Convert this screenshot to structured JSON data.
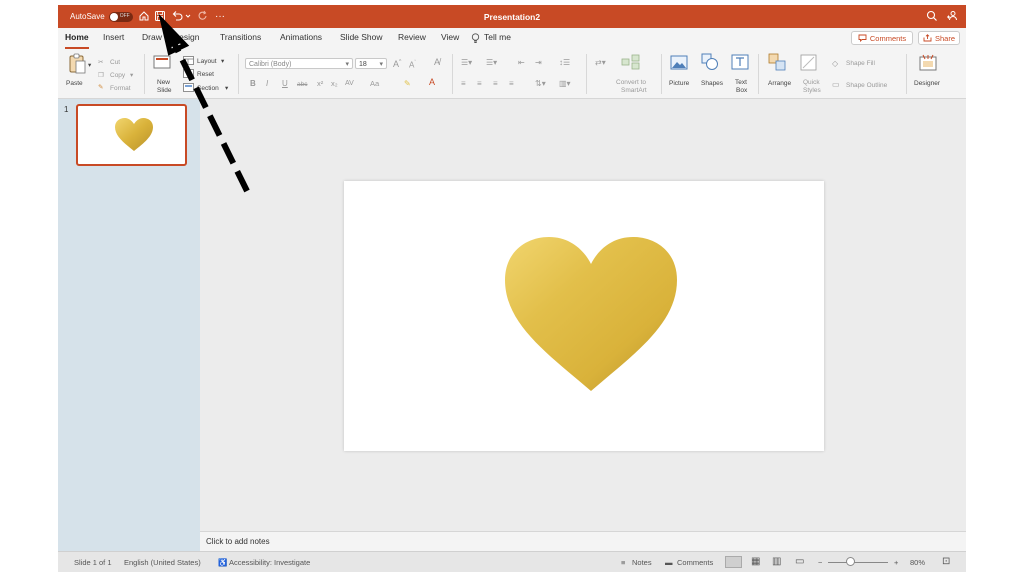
{
  "titlebar": {
    "autosave_label": "AutoSave",
    "autosave_state": "OFF",
    "document_title": "Presentation2",
    "accent_color": "#c84a25"
  },
  "tabs": [
    "Home",
    "Insert",
    "Draw",
    "Design",
    "Transitions",
    "Animations",
    "Slide Show",
    "Review",
    "View",
    "Tell me"
  ],
  "actions": {
    "comments": "Comments",
    "share": "Share"
  },
  "clipboard": {
    "paste": "Paste",
    "cut": "Cut",
    "copy": "Copy",
    "format": "Format"
  },
  "slides_group": {
    "new_slide": "New",
    "new_slide_2": "Slide",
    "layout": "Layout",
    "reset": "Reset",
    "section": "Section"
  },
  "font": {
    "name": "Calibri (Body)",
    "size": "18"
  },
  "format_buttons": [
    "B",
    "I",
    "U",
    "abc",
    "x²",
    "x₂",
    "AV",
    "Aa"
  ],
  "convert": {
    "line1": "Convert to",
    "line2": "SmartArt"
  },
  "insert_group": {
    "picture": "Picture",
    "shapes": "Shapes",
    "textbox_1": "Text",
    "textbox_2": "Box"
  },
  "drawing_group": {
    "arrange": "Arrange",
    "quick_1": "Quick",
    "quick_2": "Styles",
    "shape_fill": "Shape Fill",
    "shape_outline": "Shape Outline"
  },
  "designer": "Designer",
  "thumbnails": {
    "slide_number": "1"
  },
  "notes_placeholder": "Click to add notes",
  "status": {
    "slide_info": "Slide 1 of 1",
    "language": "English (United States)",
    "accessibility": "Accessibility: Investigate",
    "notes": "Notes",
    "comments": "Comments",
    "zoom_minus": "−",
    "zoom_plus": "+",
    "zoom": "80%",
    "zoom_level": 0.8
  },
  "colors": {
    "heart_gold": "#d9b23a",
    "heart_light": "#f1d56e",
    "heart_dark": "#b8912b"
  }
}
